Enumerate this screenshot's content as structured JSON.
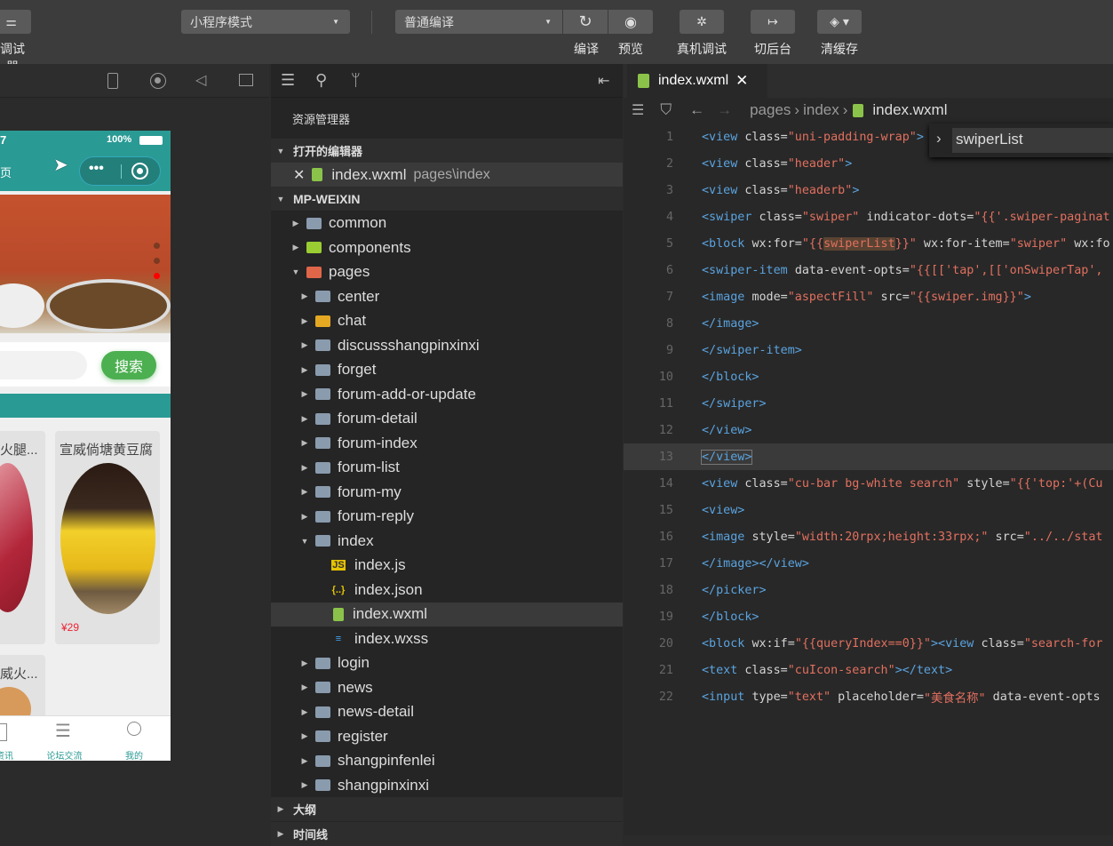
{
  "toolbar": {
    "debugger_label": "调试器",
    "mode_select": "小程序模式",
    "compile_select": "普通编译",
    "compile_label": "编译",
    "preview_label": "预览",
    "remote_debug_label": "真机调试",
    "background_label": "切后台",
    "clear_cache_label": "清缓存"
  },
  "simulator": {
    "status_time": "7",
    "battery": "100%",
    "nav_title": "页",
    "search_button": "搜索",
    "products": [
      {
        "name": "火腿...",
        "price": ""
      },
      {
        "name": "宣威倘塘黄豆腐",
        "price": "¥29"
      },
      {
        "name": "威火...",
        "price": ""
      }
    ],
    "tabbar": [
      {
        "label": "资讯",
        "icon": "news-icon"
      },
      {
        "label": "论坛交流",
        "icon": "list-icon"
      },
      {
        "label": "我的",
        "icon": "user-icon"
      }
    ],
    "theme_color": "#2a9a94"
  },
  "explorer": {
    "title": "资源管理器",
    "open_editors_label": "打开的编辑器",
    "open_file": {
      "name": "index.wxml",
      "path": "pages\\index"
    },
    "project_label": "MP-WEIXIN",
    "tree": [
      {
        "name": "common",
        "type": "folder",
        "depth": 1
      },
      {
        "name": "components",
        "type": "folder-green",
        "depth": 1
      },
      {
        "name": "pages",
        "type": "folder-red-open",
        "depth": 1
      },
      {
        "name": "center",
        "type": "folder",
        "depth": 2
      },
      {
        "name": "chat",
        "type": "folder-yellow",
        "depth": 2
      },
      {
        "name": "discussshangpinxinxi",
        "type": "folder",
        "depth": 2
      },
      {
        "name": "forget",
        "type": "folder",
        "depth": 2
      },
      {
        "name": "forum-add-or-update",
        "type": "folder",
        "depth": 2
      },
      {
        "name": "forum-detail",
        "type": "folder",
        "depth": 2
      },
      {
        "name": "forum-index",
        "type": "folder",
        "depth": 2
      },
      {
        "name": "forum-list",
        "type": "folder",
        "depth": 2
      },
      {
        "name": "forum-my",
        "type": "folder",
        "depth": 2
      },
      {
        "name": "forum-reply",
        "type": "folder",
        "depth": 2
      },
      {
        "name": "index",
        "type": "folder-open",
        "depth": 2
      },
      {
        "name": "index.js",
        "type": "js",
        "depth": 3
      },
      {
        "name": "index.json",
        "type": "json",
        "depth": 3
      },
      {
        "name": "index.wxml",
        "type": "wxml",
        "depth": 3,
        "selected": true
      },
      {
        "name": "index.wxss",
        "type": "wxss",
        "depth": 3
      },
      {
        "name": "login",
        "type": "folder",
        "depth": 2
      },
      {
        "name": "news",
        "type": "folder",
        "depth": 2
      },
      {
        "name": "news-detail",
        "type": "folder",
        "depth": 2
      },
      {
        "name": "register",
        "type": "folder",
        "depth": 2
      },
      {
        "name": "shangpinfenlei",
        "type": "folder",
        "depth": 2
      },
      {
        "name": "shangpinxinxi",
        "type": "folder",
        "depth": 2
      }
    ],
    "outline_label": "大纲",
    "timeline_label": "时间线"
  },
  "editor": {
    "tab_label": "index.wxml",
    "breadcrumb": [
      "pages",
      "index",
      "index.wxml"
    ],
    "find_widget_value": "swiperList",
    "lines": [
      [
        [
          "<view ",
          "tag"
        ],
        [
          "class=",
          "attr"
        ],
        [
          "\"uni-padding-wrap\"",
          "str"
        ],
        [
          ">",
          "tag"
        ]
      ],
      [
        [
          "<view ",
          "tag"
        ],
        [
          "class=",
          "attr"
        ],
        [
          "\"header\"",
          "str"
        ],
        [
          ">",
          "tag"
        ]
      ],
      [
        [
          "<view ",
          "tag"
        ],
        [
          "class=",
          "attr"
        ],
        [
          "\"headerb\"",
          "str"
        ],
        [
          ">",
          "tag"
        ]
      ],
      [
        [
          "<swiper ",
          "tag"
        ],
        [
          "class=",
          "attr"
        ],
        [
          "\"swiper\"",
          "str"
        ],
        [
          " indicator-dots=",
          "attr"
        ],
        [
          "\"{{'.swiper-paginat",
          "str"
        ]
      ],
      [
        [
          "<block ",
          "tag"
        ],
        [
          "wx:for=",
          "attr"
        ],
        [
          "\"{{",
          "str"
        ],
        [
          "swiperList",
          "hl"
        ],
        [
          "}}\"",
          "str"
        ],
        [
          " wx:for-item=",
          "attr"
        ],
        [
          "\"swiper\"",
          "str"
        ],
        [
          " wx:fo",
          "attr"
        ]
      ],
      [
        [
          "<swiper-item ",
          "tag"
        ],
        [
          "data-event-opts=",
          "attr"
        ],
        [
          "\"{{[['tap',[['onSwiperTap',",
          "str"
        ]
      ],
      [
        [
          "<image ",
          "tag"
        ],
        [
          "mode=",
          "attr"
        ],
        [
          "\"aspectFill\"",
          "str"
        ],
        [
          " src=",
          "attr"
        ],
        [
          "\"{{swiper.img}}\"",
          "str"
        ],
        [
          ">",
          "tag"
        ]
      ],
      [
        [
          "</image>",
          "tag"
        ]
      ],
      [
        [
          "</swiper-item>",
          "tag"
        ]
      ],
      [
        [
          "</block>",
          "tag"
        ]
      ],
      [
        [
          "</swiper>",
          "tag"
        ]
      ],
      [
        [
          "</view>",
          "tag"
        ]
      ],
      [
        [
          "</view>",
          "tag"
        ]
      ],
      [
        [
          "<view ",
          "tag"
        ],
        [
          "class=",
          "attr"
        ],
        [
          "\"cu-bar bg-white search\"",
          "str"
        ],
        [
          " style=",
          "attr"
        ],
        [
          "\"{{'top:'+(Cu",
          "str"
        ]
      ],
      [
        [
          "<view>",
          "tag"
        ]
      ],
      [
        [
          "<image ",
          "tag"
        ],
        [
          "style=",
          "attr"
        ],
        [
          "\"width:20rpx;height:33rpx;\"",
          "str"
        ],
        [
          " src=",
          "attr"
        ],
        [
          "\"../../stat",
          "str"
        ]
      ],
      [
        [
          "</image></view>",
          "tag"
        ]
      ],
      [
        [
          "</picker>",
          "tag"
        ]
      ],
      [
        [
          "</block>",
          "tag"
        ]
      ],
      [
        [
          "<block ",
          "tag"
        ],
        [
          "wx:if=",
          "attr"
        ],
        [
          "\"{{queryIndex==0}}\"",
          "str"
        ],
        [
          "><view ",
          "tag"
        ],
        [
          "class=",
          "attr"
        ],
        [
          "\"search-for",
          "str"
        ]
      ],
      [
        [
          "<text ",
          "tag"
        ],
        [
          "class=",
          "attr"
        ],
        [
          "\"cuIcon-search\"",
          "str"
        ],
        [
          "></text>",
          "tag"
        ]
      ],
      [
        [
          "<input ",
          "tag"
        ],
        [
          "type=",
          "attr"
        ],
        [
          "\"text\"",
          "str"
        ],
        [
          " placeholder=",
          "attr"
        ],
        [
          "\"美食名称\"",
          "str"
        ],
        [
          " data-event-opts",
          "attr"
        ]
      ]
    ],
    "current_line": 13,
    "colors": {
      "tag": "#5aa3df",
      "string": "#e2705f",
      "attr": "#d4d4d4"
    }
  }
}
